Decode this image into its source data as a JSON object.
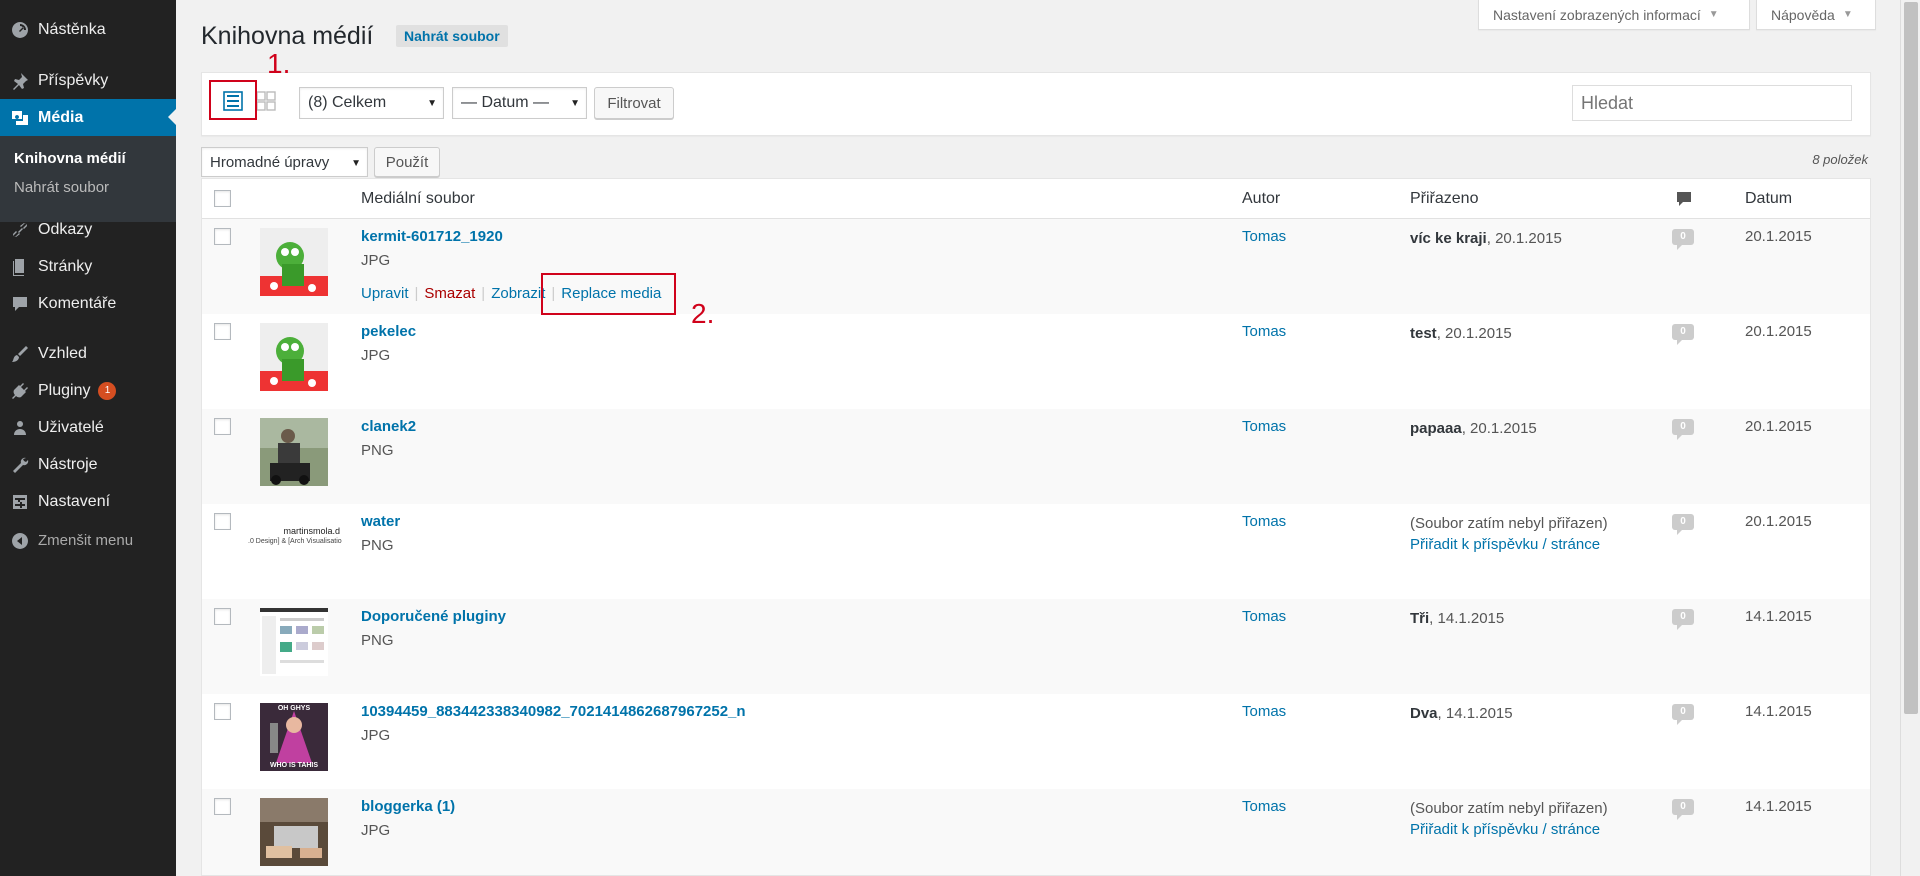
{
  "sidebar": {
    "items": [
      {
        "label": "Nástěnka",
        "icon": "dashboard-icon"
      },
      {
        "label": "Příspěvky",
        "icon": "pin-icon"
      },
      {
        "label": "Média",
        "icon": "media-icon"
      },
      {
        "label": "Odkazy",
        "icon": "link-icon"
      },
      {
        "label": "Stránky",
        "icon": "page-icon"
      },
      {
        "label": "Komentáře",
        "icon": "comment-icon"
      },
      {
        "label": "Vzhled",
        "icon": "brush-icon"
      },
      {
        "label": "Pluginy",
        "icon": "plugin-icon",
        "badge": "1"
      },
      {
        "label": "Uživatelé",
        "icon": "user-icon"
      },
      {
        "label": "Nástroje",
        "icon": "wrench-icon"
      },
      {
        "label": "Nastavení",
        "icon": "settings-icon"
      }
    ],
    "submenu": [
      "Knihovna médií",
      "Nahrát soubor"
    ],
    "collapse_label": "Zmenšit menu"
  },
  "top": {
    "screen_options": "Nastavení zobrazených informací",
    "help": "Nápověda"
  },
  "page": {
    "title": "Knihovna médií",
    "add_new": "Nahrát soubor"
  },
  "filters": {
    "type_select": "(8) Celkem",
    "date_select": "— Datum —",
    "filter_button": "Filtrovat",
    "search_placeholder": "Hledat"
  },
  "bulk": {
    "select": "Hromadné úpravy",
    "apply": "Použít",
    "count": "8 položek"
  },
  "table": {
    "headers": {
      "file": "Mediální soubor",
      "author": "Autor",
      "attached": "Přiřazeno",
      "date": "Datum"
    },
    "row_actions": {
      "edit": "Upravit",
      "delete": "Smazat",
      "view": "Zobrazit",
      "replace": "Replace media"
    },
    "rows": [
      {
        "name": "kermit-601712_1920",
        "type": "JPG",
        "author": "Tomas",
        "attached_bold": "víc ke kraji",
        "attached_date": ", 20.1.2015",
        "attach_link": "",
        "comments": "0",
        "date": "20.1.2015"
      },
      {
        "name": "pekelec",
        "type": "JPG",
        "author": "Tomas",
        "attached_bold": "test",
        "attached_date": ", 20.1.2015",
        "attach_link": "",
        "comments": "0",
        "date": "20.1.2015"
      },
      {
        "name": "clanek2",
        "type": "PNG",
        "author": "Tomas",
        "attached_bold": "papaaa",
        "attached_date": ", 20.1.2015",
        "attach_link": "",
        "comments": "0",
        "date": "20.1.2015"
      },
      {
        "name": "water",
        "type": "PNG",
        "author": "Tomas",
        "attached_bold": "",
        "attached_date": "(Soubor zatím nebyl přiřazen)",
        "attach_link": "Přiřadit k příspěvku / stránce",
        "comments": "0",
        "date": "20.1.2015"
      },
      {
        "name": "Doporučené pluginy",
        "type": "PNG",
        "author": "Tomas",
        "attached_bold": "Tři",
        "attached_date": ", 14.1.2015",
        "attach_link": "",
        "comments": "0",
        "date": "14.1.2015"
      },
      {
        "name": "10394459_883442338340982_7021414862687967252_n",
        "type": "JPG",
        "author": "Tomas",
        "attached_bold": "Dva",
        "attached_date": ", 14.1.2015",
        "attach_link": "",
        "comments": "0",
        "date": "14.1.2015"
      },
      {
        "name": "bloggerka (1)",
        "type": "JPG",
        "author": "Tomas",
        "attached_bold": "",
        "attached_date": "(Soubor zatím nebyl přiřazen)",
        "attach_link": "Přiřadit k příspěvku / stránce",
        "comments": "0",
        "date": "14.1.2015"
      }
    ],
    "thumb_text": {
      "water_line1": "martinsmola.d",
      "water_line2": ".0 Design] & [Arch Visualisatio",
      "meme_top": "OH GHYS",
      "meme_bottom": "WHO IS TAHIS"
    }
  },
  "annotations": {
    "one": "1.",
    "two": "2."
  },
  "colors": {
    "sidebar": "#222222",
    "active": "#0073aa",
    "link": "#0073aa",
    "delete": "#aa0000",
    "annotation": "#d0021b"
  }
}
